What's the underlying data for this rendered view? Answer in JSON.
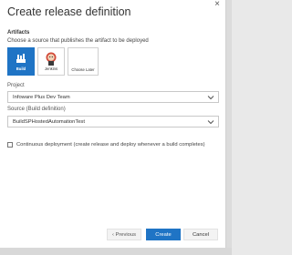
{
  "dialog": {
    "title": "Create release definition",
    "close_glyph": "×"
  },
  "artifacts": {
    "heading": "Artifacts",
    "subtitle": "Choose a source that publishes the artifact to be deployed",
    "tiles": [
      {
        "label": "Build",
        "icon": "build-icon",
        "selected": true
      },
      {
        "label": "Jenkins",
        "icon": "jenkins-icon",
        "selected": false
      },
      {
        "label": "Choose Later",
        "icon": "",
        "selected": false
      }
    ]
  },
  "project": {
    "label": "Project",
    "value": "Infoware Plus Dev Team"
  },
  "source": {
    "label": "Source (Build definition)",
    "value": "BuildSPHostedAutomationTest"
  },
  "continuous_deployment": {
    "label": "Continuous deployment (create release and deploy whenever a build completes)",
    "checked": false
  },
  "footer": {
    "previous_label": "‹ Previous",
    "create_label": "Create",
    "cancel_label": "Cancel"
  },
  "colors": {
    "accent": "#1f74c5"
  }
}
